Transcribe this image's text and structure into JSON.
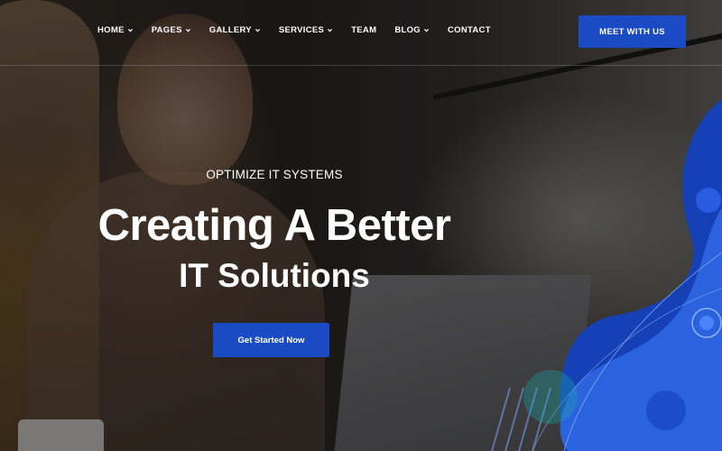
{
  "nav": {
    "items": [
      {
        "label": "HOME",
        "dropdown": true
      },
      {
        "label": "PAGES",
        "dropdown": true
      },
      {
        "label": "GALLERY",
        "dropdown": true
      },
      {
        "label": "SERVICES",
        "dropdown": true
      },
      {
        "label": "TEAM",
        "dropdown": false
      },
      {
        "label": "BLOG",
        "dropdown": true
      },
      {
        "label": "CONTACT",
        "dropdown": false
      }
    ],
    "cta_label": "MEET WITH US"
  },
  "hero": {
    "subtitle": "OPTIMIZE IT SYSTEMS",
    "title_line1": "Creating A Better",
    "title_line2": "IT Solutions",
    "cta_label": "Get Started Now"
  },
  "colors": {
    "accent": "#1a4bc4",
    "text": "#ffffff",
    "wave_dark": "#1640b5",
    "wave_light": "#2f6ae6"
  }
}
